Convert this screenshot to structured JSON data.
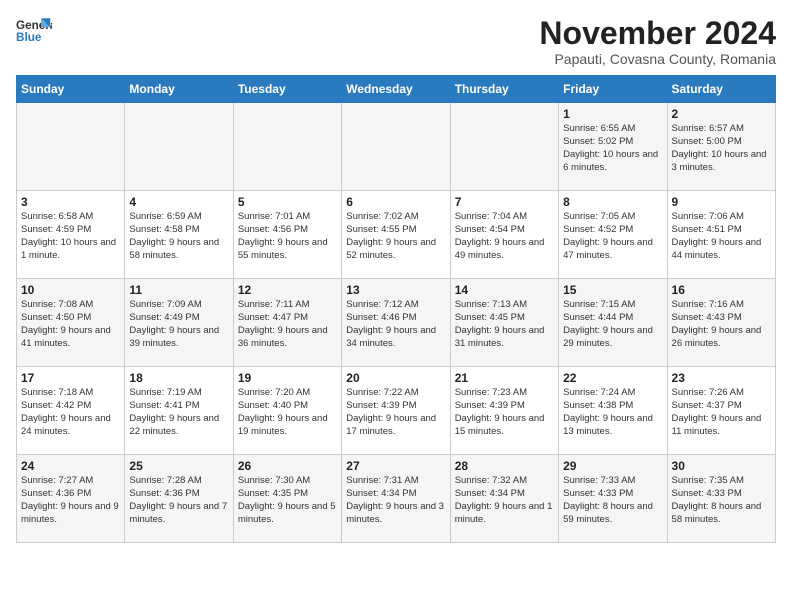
{
  "header": {
    "logo_general": "General",
    "logo_blue": "Blue",
    "month_title": "November 2024",
    "subtitle": "Papauti, Covasna County, Romania"
  },
  "days_of_week": [
    "Sunday",
    "Monday",
    "Tuesday",
    "Wednesday",
    "Thursday",
    "Friday",
    "Saturday"
  ],
  "weeks": [
    [
      {
        "day": "",
        "content": ""
      },
      {
        "day": "",
        "content": ""
      },
      {
        "day": "",
        "content": ""
      },
      {
        "day": "",
        "content": ""
      },
      {
        "day": "",
        "content": ""
      },
      {
        "day": "1",
        "content": "Sunrise: 6:55 AM\nSunset: 5:02 PM\nDaylight: 10 hours\nand 6 minutes."
      },
      {
        "day": "2",
        "content": "Sunrise: 6:57 AM\nSunset: 5:00 PM\nDaylight: 10 hours\nand 3 minutes."
      }
    ],
    [
      {
        "day": "3",
        "content": "Sunrise: 6:58 AM\nSunset: 4:59 PM\nDaylight: 10 hours\nand 1 minute."
      },
      {
        "day": "4",
        "content": "Sunrise: 6:59 AM\nSunset: 4:58 PM\nDaylight: 9 hours\nand 58 minutes."
      },
      {
        "day": "5",
        "content": "Sunrise: 7:01 AM\nSunset: 4:56 PM\nDaylight: 9 hours\nand 55 minutes."
      },
      {
        "day": "6",
        "content": "Sunrise: 7:02 AM\nSunset: 4:55 PM\nDaylight: 9 hours\nand 52 minutes."
      },
      {
        "day": "7",
        "content": "Sunrise: 7:04 AM\nSunset: 4:54 PM\nDaylight: 9 hours\nand 49 minutes."
      },
      {
        "day": "8",
        "content": "Sunrise: 7:05 AM\nSunset: 4:52 PM\nDaylight: 9 hours\nand 47 minutes."
      },
      {
        "day": "9",
        "content": "Sunrise: 7:06 AM\nSunset: 4:51 PM\nDaylight: 9 hours\nand 44 minutes."
      }
    ],
    [
      {
        "day": "10",
        "content": "Sunrise: 7:08 AM\nSunset: 4:50 PM\nDaylight: 9 hours\nand 41 minutes."
      },
      {
        "day": "11",
        "content": "Sunrise: 7:09 AM\nSunset: 4:49 PM\nDaylight: 9 hours\nand 39 minutes."
      },
      {
        "day": "12",
        "content": "Sunrise: 7:11 AM\nSunset: 4:47 PM\nDaylight: 9 hours\nand 36 minutes."
      },
      {
        "day": "13",
        "content": "Sunrise: 7:12 AM\nSunset: 4:46 PM\nDaylight: 9 hours\nand 34 minutes."
      },
      {
        "day": "14",
        "content": "Sunrise: 7:13 AM\nSunset: 4:45 PM\nDaylight: 9 hours\nand 31 minutes."
      },
      {
        "day": "15",
        "content": "Sunrise: 7:15 AM\nSunset: 4:44 PM\nDaylight: 9 hours\nand 29 minutes."
      },
      {
        "day": "16",
        "content": "Sunrise: 7:16 AM\nSunset: 4:43 PM\nDaylight: 9 hours\nand 26 minutes."
      }
    ],
    [
      {
        "day": "17",
        "content": "Sunrise: 7:18 AM\nSunset: 4:42 PM\nDaylight: 9 hours\nand 24 minutes."
      },
      {
        "day": "18",
        "content": "Sunrise: 7:19 AM\nSunset: 4:41 PM\nDaylight: 9 hours\nand 22 minutes."
      },
      {
        "day": "19",
        "content": "Sunrise: 7:20 AM\nSunset: 4:40 PM\nDaylight: 9 hours\nand 19 minutes."
      },
      {
        "day": "20",
        "content": "Sunrise: 7:22 AM\nSunset: 4:39 PM\nDaylight: 9 hours\nand 17 minutes."
      },
      {
        "day": "21",
        "content": "Sunrise: 7:23 AM\nSunset: 4:39 PM\nDaylight: 9 hours\nand 15 minutes."
      },
      {
        "day": "22",
        "content": "Sunrise: 7:24 AM\nSunset: 4:38 PM\nDaylight: 9 hours\nand 13 minutes."
      },
      {
        "day": "23",
        "content": "Sunrise: 7:26 AM\nSunset: 4:37 PM\nDaylight: 9 hours\nand 11 minutes."
      }
    ],
    [
      {
        "day": "24",
        "content": "Sunrise: 7:27 AM\nSunset: 4:36 PM\nDaylight: 9 hours\nand 9 minutes."
      },
      {
        "day": "25",
        "content": "Sunrise: 7:28 AM\nSunset: 4:36 PM\nDaylight: 9 hours\nand 7 minutes."
      },
      {
        "day": "26",
        "content": "Sunrise: 7:30 AM\nSunset: 4:35 PM\nDaylight: 9 hours\nand 5 minutes."
      },
      {
        "day": "27",
        "content": "Sunrise: 7:31 AM\nSunset: 4:34 PM\nDaylight: 9 hours\nand 3 minutes."
      },
      {
        "day": "28",
        "content": "Sunrise: 7:32 AM\nSunset: 4:34 PM\nDaylight: 9 hours\nand 1 minute."
      },
      {
        "day": "29",
        "content": "Sunrise: 7:33 AM\nSunset: 4:33 PM\nDaylight: 8 hours\nand 59 minutes."
      },
      {
        "day": "30",
        "content": "Sunrise: 7:35 AM\nSunset: 4:33 PM\nDaylight: 8 hours\nand 58 minutes."
      }
    ]
  ]
}
